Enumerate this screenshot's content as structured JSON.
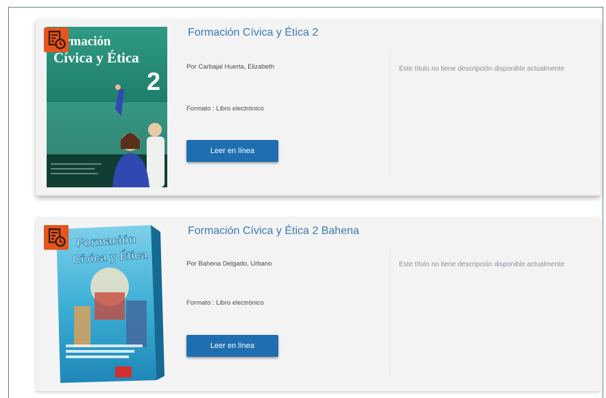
{
  "books": [
    {
      "title": "Formación Cívica y Ética 2",
      "author": "Por Carbajal Huerta, Elizabeth",
      "format": "Formato : Libro electrónico",
      "button_label": "Leer en línea",
      "description": "Este título no tiene descripción disponible actualmente",
      "badge_icon": "ebook-icon",
      "cover": {
        "line1": "rmación",
        "line2": "Cívica y Ética",
        "number": "2"
      }
    },
    {
      "title": "Formación Cívica y Ética 2 Bahena",
      "author": "Por Bahena Delgado, Urbano",
      "format": "Formato : Libro electrónico",
      "button_label": "Leer en línea",
      "description": "Este título no tiene descripción disponible actualmente",
      "badge_icon": "ebook-icon",
      "cover": {
        "line1": "Formación",
        "line2": "Cívica y Ética"
      }
    }
  ],
  "colors": {
    "accent": "#1f6fb0",
    "title": "#3a78b5",
    "badge": "#e4561b",
    "frame": "#5b7fa6"
  }
}
